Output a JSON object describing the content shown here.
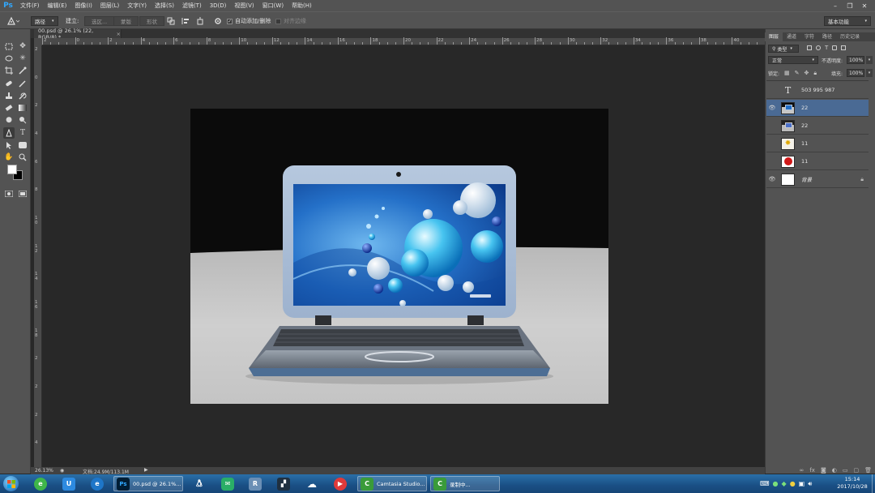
{
  "app": {
    "logo": "Ps"
  },
  "menu": [
    "文件(F)",
    "编辑(E)",
    "图像(I)",
    "图层(L)",
    "文字(Y)",
    "选择(S)",
    "滤镜(T)",
    "3D(D)",
    "视图(V)",
    "窗口(W)",
    "帮助(H)"
  ],
  "window_controls": {
    "minimize": "–",
    "restore": "❐",
    "close": "✕"
  },
  "options": {
    "tool_icon": "pen-tool-icon",
    "mode": "路径",
    "make_label": "建立:",
    "selection_btn": "选区...",
    "mask_btn": "蒙版",
    "shape_btn": "形状",
    "auto_add_delete": {
      "label": "自动添加/删除",
      "checked": true
    },
    "align_edges": {
      "label": "对齐边缘",
      "checked": false
    },
    "workspace": "基本功能"
  },
  "document_tab": {
    "title": "00.psd @ 26.1% (22, RGB/8) *",
    "close": "×"
  },
  "rulers": {
    "top_labels": [
      "2",
      "0",
      "2",
      "4",
      "6",
      "8",
      "10",
      "12",
      "14",
      "16",
      "18",
      "20",
      "22",
      "24",
      "26",
      "28",
      "30",
      "32",
      "34",
      "36",
      "38",
      "40"
    ],
    "left_labels": [
      "2",
      "0",
      "2",
      "4",
      "6",
      "8",
      "1 0",
      "1 2",
      "1 4",
      "1 6",
      "1 8",
      "2",
      "2",
      "2",
      "4"
    ]
  },
  "panel": {
    "tabs": [
      "图层",
      "通道",
      "字符",
      "路径",
      "历史记录"
    ],
    "active_tab": "图层",
    "filter": "类型",
    "blend_mode": "正常",
    "opacity_label": "不透明度:",
    "opacity": "100%",
    "lock_label": "锁定:",
    "fill_label": "填充:",
    "fill": "100%"
  },
  "layers": [
    {
      "name": "503 995 987",
      "type": "text",
      "visible": false,
      "selected": false
    },
    {
      "name": "22",
      "type": "image",
      "visible": true,
      "selected": true
    },
    {
      "name": "22",
      "type": "image",
      "visible": false,
      "selected": false
    },
    {
      "name": "11",
      "type": "image",
      "visible": false,
      "selected": false
    },
    {
      "name": "11",
      "type": "image",
      "visible": false,
      "selected": false
    },
    {
      "name": "背景",
      "type": "background",
      "visible": true,
      "selected": false,
      "locked": true
    }
  ],
  "status": {
    "zoom": "26.13%",
    "doc_info": "文档:24.9M/113.1M"
  },
  "taskbar": {
    "ps_window": "00.psd @ 26.1%...",
    "camtasia": "Camtasia Studio...",
    "recorder": "录制中...",
    "time": "15:14",
    "date": "2017/10/28"
  },
  "colors": {
    "accent": "#31a8ff",
    "selected_layer": "#4a6a94",
    "canvas_bg": "#0b0b0b",
    "floor": "#c7c7c7"
  }
}
